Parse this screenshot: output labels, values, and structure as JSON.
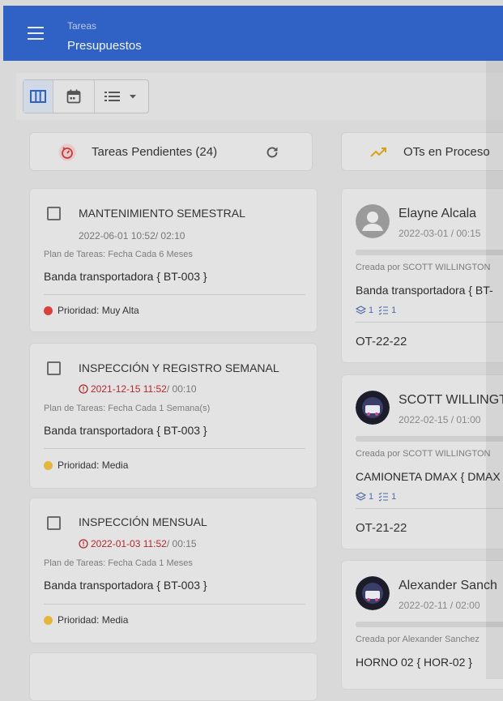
{
  "header": {
    "breadcrumb": "Tareas",
    "title": "Presupuestos"
  },
  "colors": {
    "appbar": "#2f62c4",
    "priority_high": "#d8423d",
    "priority_medium": "#e3b73b",
    "overdue": "#b3282d"
  },
  "columns": {
    "pending": {
      "title": "Tareas Pendientes (24)",
      "icon": "timer-icon",
      "refresh_icon": "refresh-icon"
    },
    "in_process": {
      "title": "OTs en Proceso",
      "icon": "trending-up-icon"
    }
  },
  "tasks": [
    {
      "title": "MANTENIMIENTO SEMESTRAL",
      "date": "2022-06-01 10:52",
      "duration": "/ 02:10",
      "plan": "Plan de Tareas: Fecha Cada 6 Meses",
      "asset": "Banda transportadora { BT-003 }",
      "priority": "Prioridad: Muy Alta"
    },
    {
      "title": "INSPECCIÓN Y REGISTRO SEMANAL",
      "date": "2021-12-15 11:52",
      "duration": "/ 00:10",
      "plan": "Plan de Tareas: Fecha Cada 1 Semana(s)",
      "asset": "Banda transportadora { BT-003 }",
      "priority": "Prioridad: Media"
    },
    {
      "title": "INSPECCIÓN MENSUAL",
      "date": "2022-01-03 11:52",
      "duration": "/ 00:15",
      "plan": "Plan de Tareas: Fecha Cada 1 Meses",
      "asset": "Banda transportadora { BT-003 }",
      "priority": "Prioridad: Media"
    }
  ],
  "work_orders": [
    {
      "name": "Elayne Alcala",
      "date": "2022-03-01 / 00:15",
      "created": "Creada por SCOTT WILLINGTON",
      "asset": "Banda transportadora { BT-",
      "layers": "1",
      "checklist": "1",
      "code": "OT-22-22"
    },
    {
      "name": "SCOTT WILLINGT",
      "date": "2022-02-15 / 01:00",
      "created": "Creada por SCOTT WILLINGTON",
      "asset": "CAMIONETA DMAX { DMAX",
      "layers": "1",
      "checklist": "1",
      "code": "OT-21-22"
    },
    {
      "name": "Alexander Sanch",
      "date": "2022-02-11 / 02:00",
      "created": "Creada por Alexander Sanchez",
      "asset": "HORNO 02 { HOR-02 }"
    }
  ]
}
